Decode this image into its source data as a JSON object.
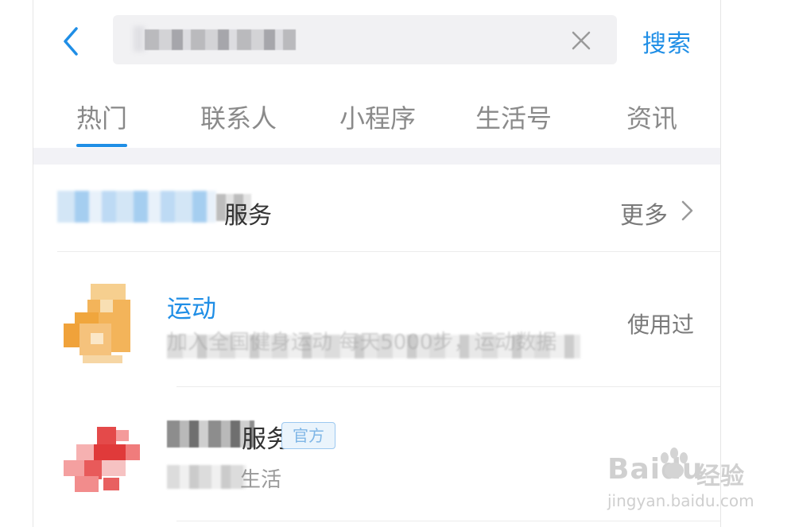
{
  "header": {
    "search_query": "█████",
    "search_button_label": "搜索"
  },
  "tabs": [
    {
      "label": "热门",
      "active": true
    },
    {
      "label": "联系人",
      "active": false
    },
    {
      "label": "小程序",
      "active": false
    },
    {
      "label": "生活号",
      "active": false
    },
    {
      "label": "资讯",
      "active": false
    }
  ],
  "section": {
    "title_suffix": "服务",
    "more_label": "更多"
  },
  "results": [
    {
      "name": "运动",
      "description": "加入全国健身运动 每天5000步，运动数据",
      "status": "使用过",
      "icon": "orange-sneaker-icon",
      "icon_color": "#f2a93b"
    },
    {
      "name_suffix": "服务",
      "badge": "官方",
      "description_suffix": "生活",
      "icon": "red-logo-icon",
      "icon_color": "#e84a4a"
    }
  ],
  "watermark": {
    "logo_text": "Baidu",
    "logo_text_cn": "经验",
    "url": "jingyan.baidu.com"
  },
  "colors": {
    "accent": "#1f8ee6",
    "muted_text": "#7a7a7a",
    "band": "#f2f2f6"
  }
}
